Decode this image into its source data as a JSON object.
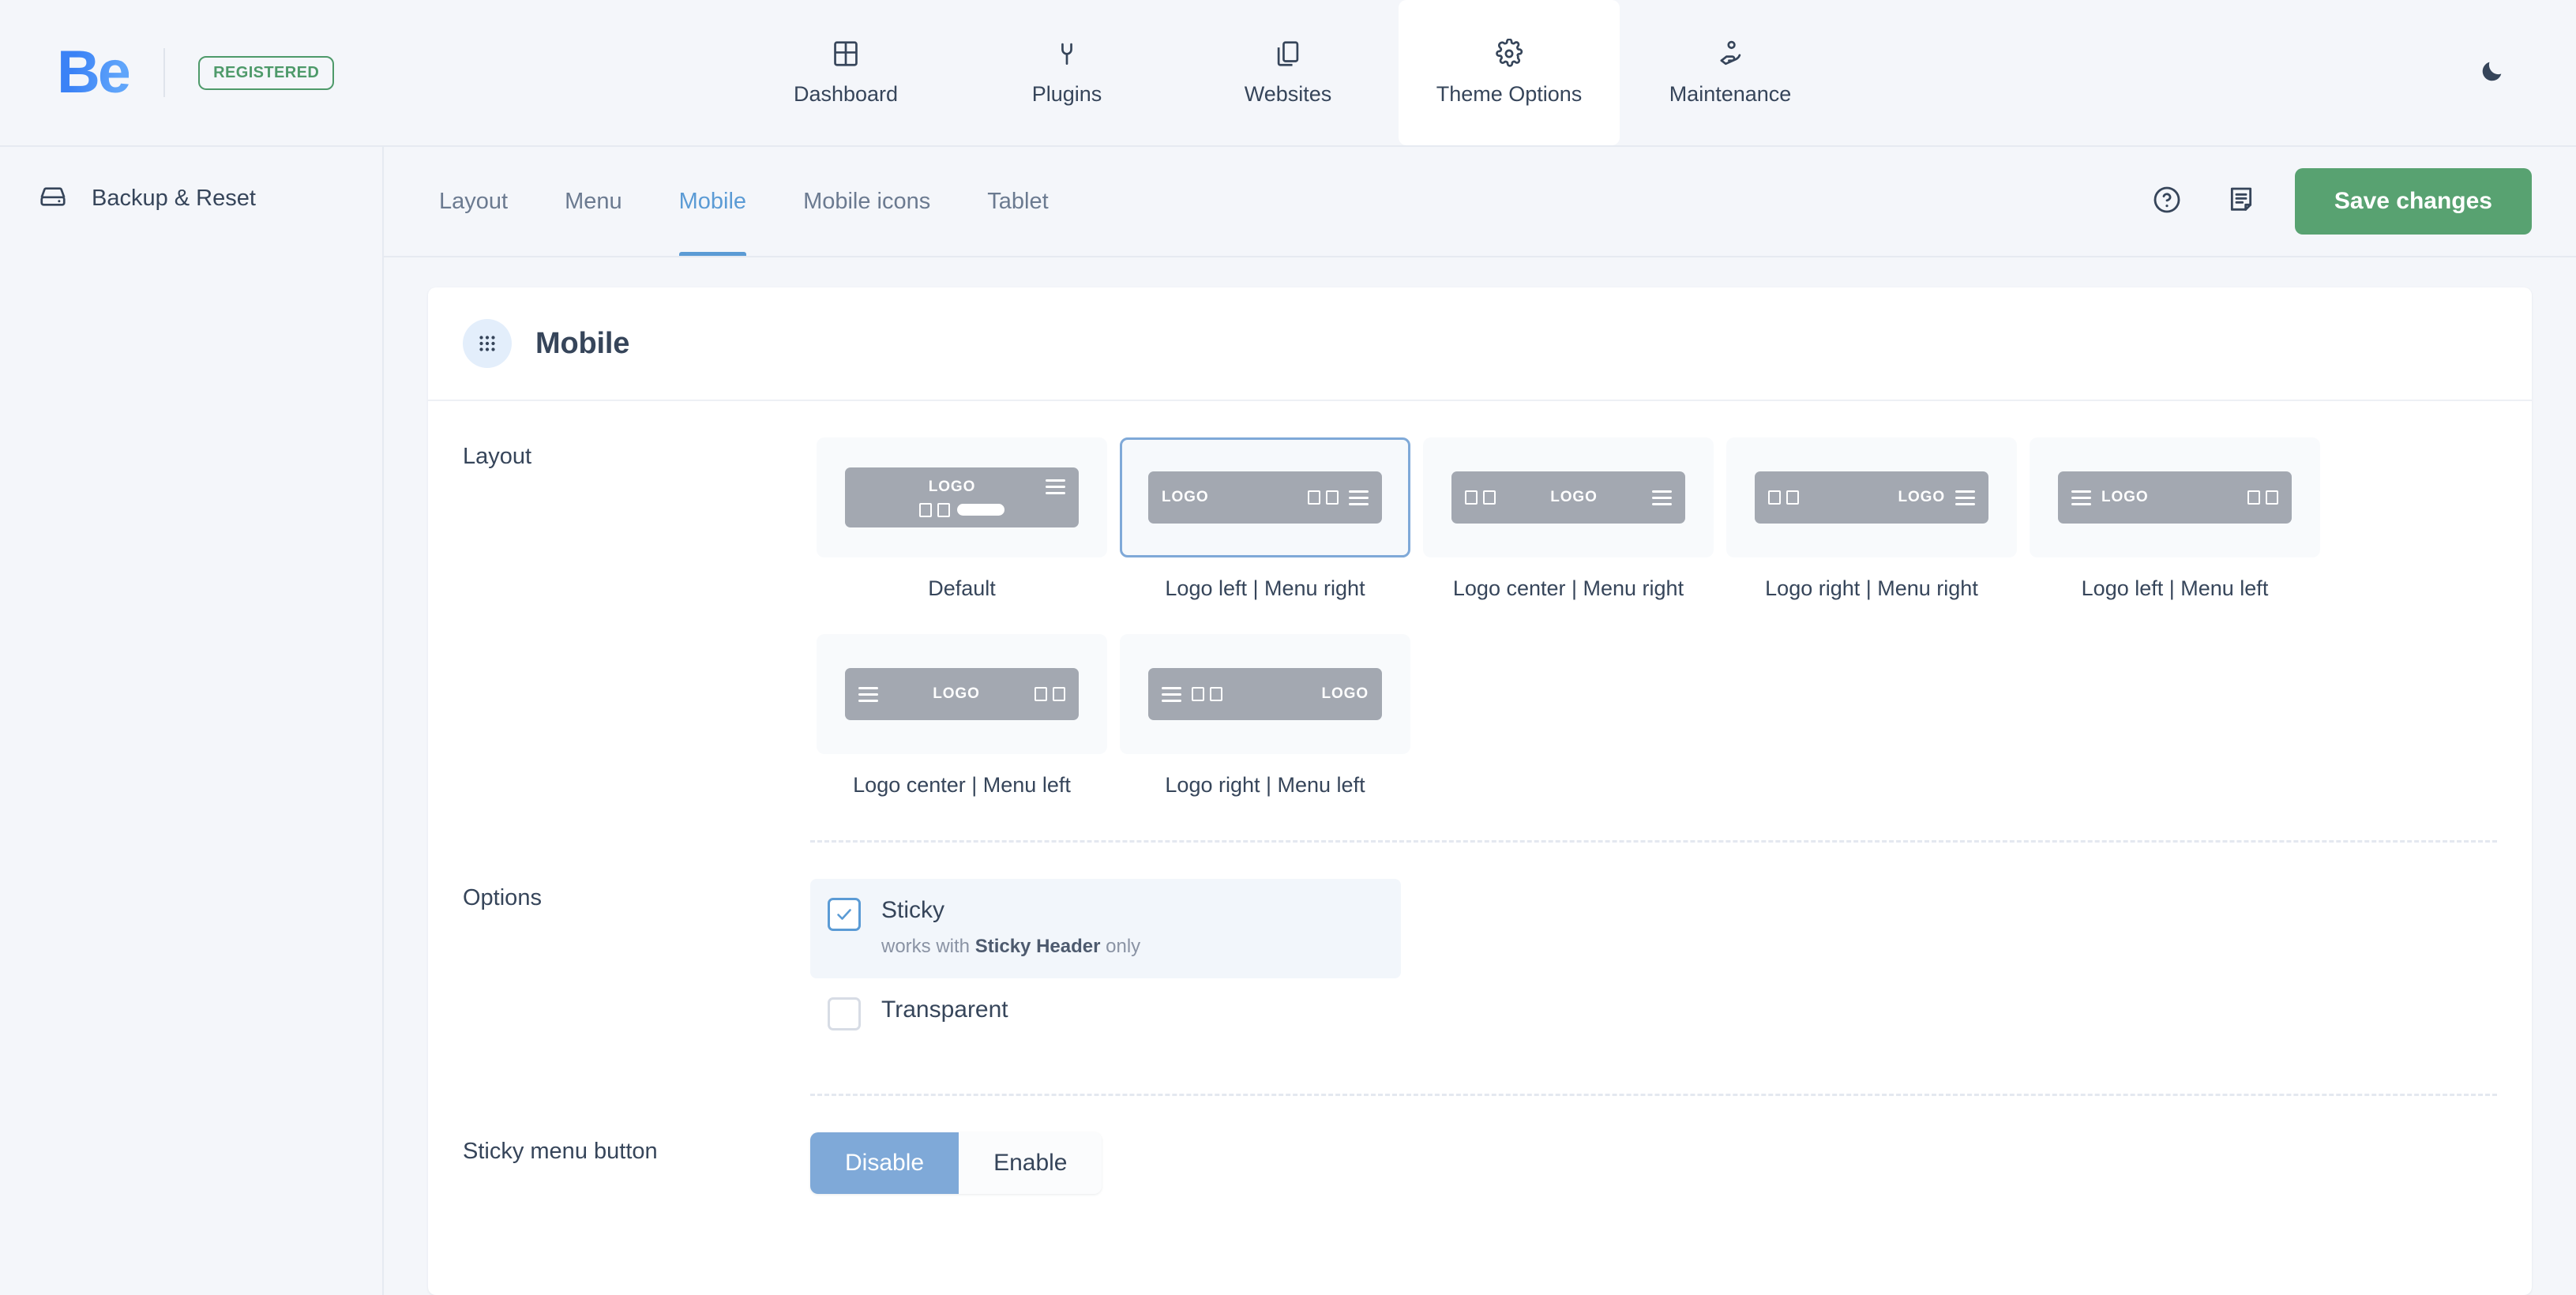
{
  "brand": {
    "logo_text": "Be",
    "badge": "REGISTERED"
  },
  "topnav": {
    "items": [
      {
        "label": "Dashboard",
        "icon": "dashboard-grid-icon",
        "active": false
      },
      {
        "label": "Plugins",
        "icon": "plug-icon",
        "active": false
      },
      {
        "label": "Websites",
        "icon": "copy-pages-icon",
        "active": false
      },
      {
        "label": "Theme Options",
        "icon": "gear-icon",
        "active": true
      },
      {
        "label": "Maintenance",
        "icon": "maintenance-hand-icon",
        "active": false
      }
    ],
    "dark_mode_icon": "moon-icon"
  },
  "sidebar": {
    "items": [
      {
        "label": "Backup & Reset",
        "icon": "hard-drive-icon"
      }
    ]
  },
  "tabstrip": {
    "tabs": [
      {
        "label": "Layout",
        "active": false
      },
      {
        "label": "Menu",
        "active": false
      },
      {
        "label": "Mobile",
        "active": true
      },
      {
        "label": "Mobile icons",
        "active": false
      },
      {
        "label": "Tablet",
        "active": false
      }
    ],
    "help_icon": "question-circle-icon",
    "notes_icon": "document-lines-icon",
    "save_label": "Save changes"
  },
  "card": {
    "title": "Mobile",
    "icon": "dots-grid-icon",
    "rows": {
      "layout": {
        "label": "Layout",
        "options": [
          {
            "label": "Default",
            "logo": "LOGO",
            "selected": false,
            "style": "two-row",
            "logo_align": "center",
            "menu": "right",
            "squares": 2,
            "pill": true
          },
          {
            "label": "Logo left | Menu right",
            "logo": "LOGO",
            "selected": true,
            "style": "one-row",
            "logo_align": "left",
            "menu": "right",
            "squares": 2,
            "pill": false
          },
          {
            "label": "Logo center | Menu right",
            "logo": "LOGO",
            "selected": false,
            "style": "one-row",
            "logo_align": "center",
            "menu": "right",
            "squares": 2,
            "pill": false
          },
          {
            "label": "Logo right | Menu right",
            "logo": "LOGO",
            "selected": false,
            "style": "one-row",
            "logo_align": "right",
            "menu": "right",
            "squares": 2,
            "pill": false
          },
          {
            "label": "Logo left | Menu left",
            "logo": "LOGO",
            "selected": false,
            "style": "one-row",
            "logo_align": "left",
            "menu": "left",
            "squares": 2,
            "pill": false
          },
          {
            "label": "Logo center | Menu left",
            "logo": "LOGO",
            "selected": false,
            "style": "one-row",
            "logo_align": "center",
            "menu": "left",
            "squares": 2,
            "pill": false
          },
          {
            "label": "Logo right | Menu left",
            "logo": "LOGO",
            "selected": false,
            "style": "one-row",
            "logo_align": "right",
            "menu": "left",
            "squares": 2,
            "pill": false
          }
        ]
      },
      "options": {
        "label": "Options",
        "items": [
          {
            "label": "Sticky",
            "checked": true,
            "note_prefix": "works with ",
            "note_bold": "Sticky Header",
            "note_suffix": " only"
          },
          {
            "label": "Transparent",
            "checked": false
          }
        ]
      },
      "sticky_menu_button": {
        "label": "Sticky menu button",
        "segments": [
          {
            "label": "Disable",
            "active": true
          },
          {
            "label": "Enable",
            "active": false
          }
        ]
      }
    }
  },
  "colors": {
    "accent_blue": "#5b9bd5",
    "save_green": "#58a271",
    "registered_green": "#4e9a6a",
    "page_bg": "#f4f6fa",
    "text_dark": "#36455a",
    "preview_bar": "#a3a8b1"
  }
}
